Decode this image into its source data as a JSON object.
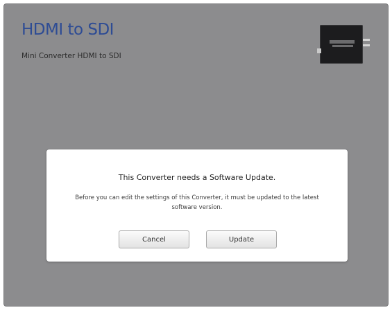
{
  "product": {
    "title": "HDMI to SDI",
    "subtitle": "Mini Converter HDMI to SDI",
    "image_icon": "mini-converter-device-icon"
  },
  "dialog": {
    "title": "This Converter needs a Software Update.",
    "message": "Before you can edit the settings of this Converter, it must be updated to the latest software version.",
    "buttons": {
      "cancel_label": "Cancel",
      "update_label": "Update"
    }
  },
  "colors": {
    "background": "#8c8c8e",
    "title_blue": "#2e4c94",
    "dialog": "#ffffff"
  }
}
